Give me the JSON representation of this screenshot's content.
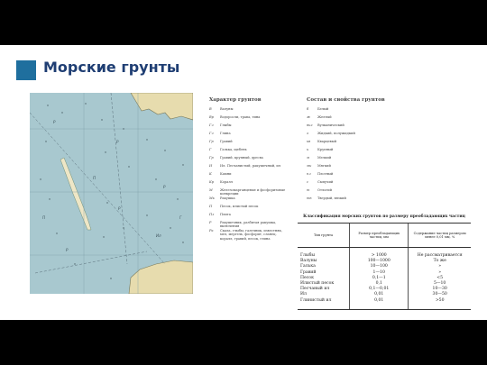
{
  "title": "Морские грунты",
  "colors": {
    "accent": "#1f6f9e",
    "title": "#1f3e73",
    "sea": "#a8c8cf",
    "land": "#e7dcae",
    "bar": "#000000"
  },
  "map": {
    "labels": [
      "Р",
      "Р",
      "Р",
      "П",
      "Р",
      "П",
      "Ил",
      "Р",
      "Г"
    ]
  },
  "legend1": {
    "header": "Характер грунтов",
    "rows": [
      {
        "abbr": "В",
        "desc": "Валуны"
      },
      {
        "abbr": "Вр",
        "desc": "Водоросли, трава, тина"
      },
      {
        "abbr": "Гл",
        "desc": "Глыбы"
      },
      {
        "abbr": "Гл",
        "desc": "Глина"
      },
      {
        "abbr": "Гр",
        "desc": "Гравий"
      },
      {
        "abbr": "Г",
        "desc": "Галька, щебень"
      },
      {
        "abbr": "Гр",
        "desc": "Гравий, крупный, дресва"
      },
      {
        "abbr": "И",
        "desc": "Ил. Песчанистый, ракушечный, ил"
      },
      {
        "abbr": "К",
        "desc": "Камни"
      },
      {
        "abbr": "Кр",
        "desc": "Коралл"
      },
      {
        "abbr": "М",
        "desc": "Железомарганцевые и фосфоритовые конкреции"
      },
      {
        "abbr": "Мк",
        "desc": "Ракушка"
      },
      {
        "abbr": "П",
        "desc": "Песок, илистый песок"
      },
      {
        "abbr": "Пл",
        "desc": "Плита"
      },
      {
        "abbr": "Р",
        "desc": "Ракушечник, разбитая ракушка, включения"
      },
      {
        "abbr": "Рк",
        "desc": "Скала, глыбы, галечник, известняк, мел, мергель, фосфорит, сланец, коралл, гравий, песок, глина"
      }
    ]
  },
  "legend2": {
    "header": "Состав и свойства грунтов",
    "rows": [
      {
        "abbr": "б",
        "desc": "Белый"
      },
      {
        "abbr": "ж",
        "desc": "Желтый"
      },
      {
        "abbr": "вкл",
        "desc": "Вулканический"
      },
      {
        "abbr": "з",
        "desc": "Жидкий, полужидкий"
      },
      {
        "abbr": "кв",
        "desc": "Кварцевый"
      },
      {
        "abbr": "к",
        "desc": "Крупный"
      },
      {
        "abbr": "м",
        "desc": "Мелкий"
      },
      {
        "abbr": "мк",
        "desc": "Мягкий"
      },
      {
        "abbr": "пл",
        "desc": "Плотный"
      },
      {
        "abbr": "с",
        "desc": "Сыпучий"
      },
      {
        "abbr": "т",
        "desc": "Отлогий"
      },
      {
        "abbr": "тв",
        "desc": "Твердый, вязкий"
      }
    ]
  },
  "classification": {
    "caption": "Классификация морских грунтов по размеру преобладающих частиц",
    "headers": [
      "Тип грунта",
      "Размер преобладающих частиц, мм",
      "Содержание частиц размером менее 0,01 мм, %"
    ],
    "rows": [
      [
        "Глыбы",
        "> 1000",
        "Не рассматривается"
      ],
      [
        "Валуны",
        "100—1000",
        "То же"
      ],
      [
        "Галька",
        "10—100",
        "»"
      ],
      [
        "Гравий",
        "1—10",
        "»"
      ],
      [
        "Песок",
        "0,1—1",
        "<5"
      ],
      [
        "Илистый песок",
        "0,1",
        "5—10"
      ],
      [
        "Песчаный ил",
        "0,1—0,01",
        "10—30"
      ],
      [
        "Ил",
        "0,01",
        "30—50"
      ],
      [
        "Глинистый ил",
        "0,01",
        ">50"
      ]
    ]
  }
}
